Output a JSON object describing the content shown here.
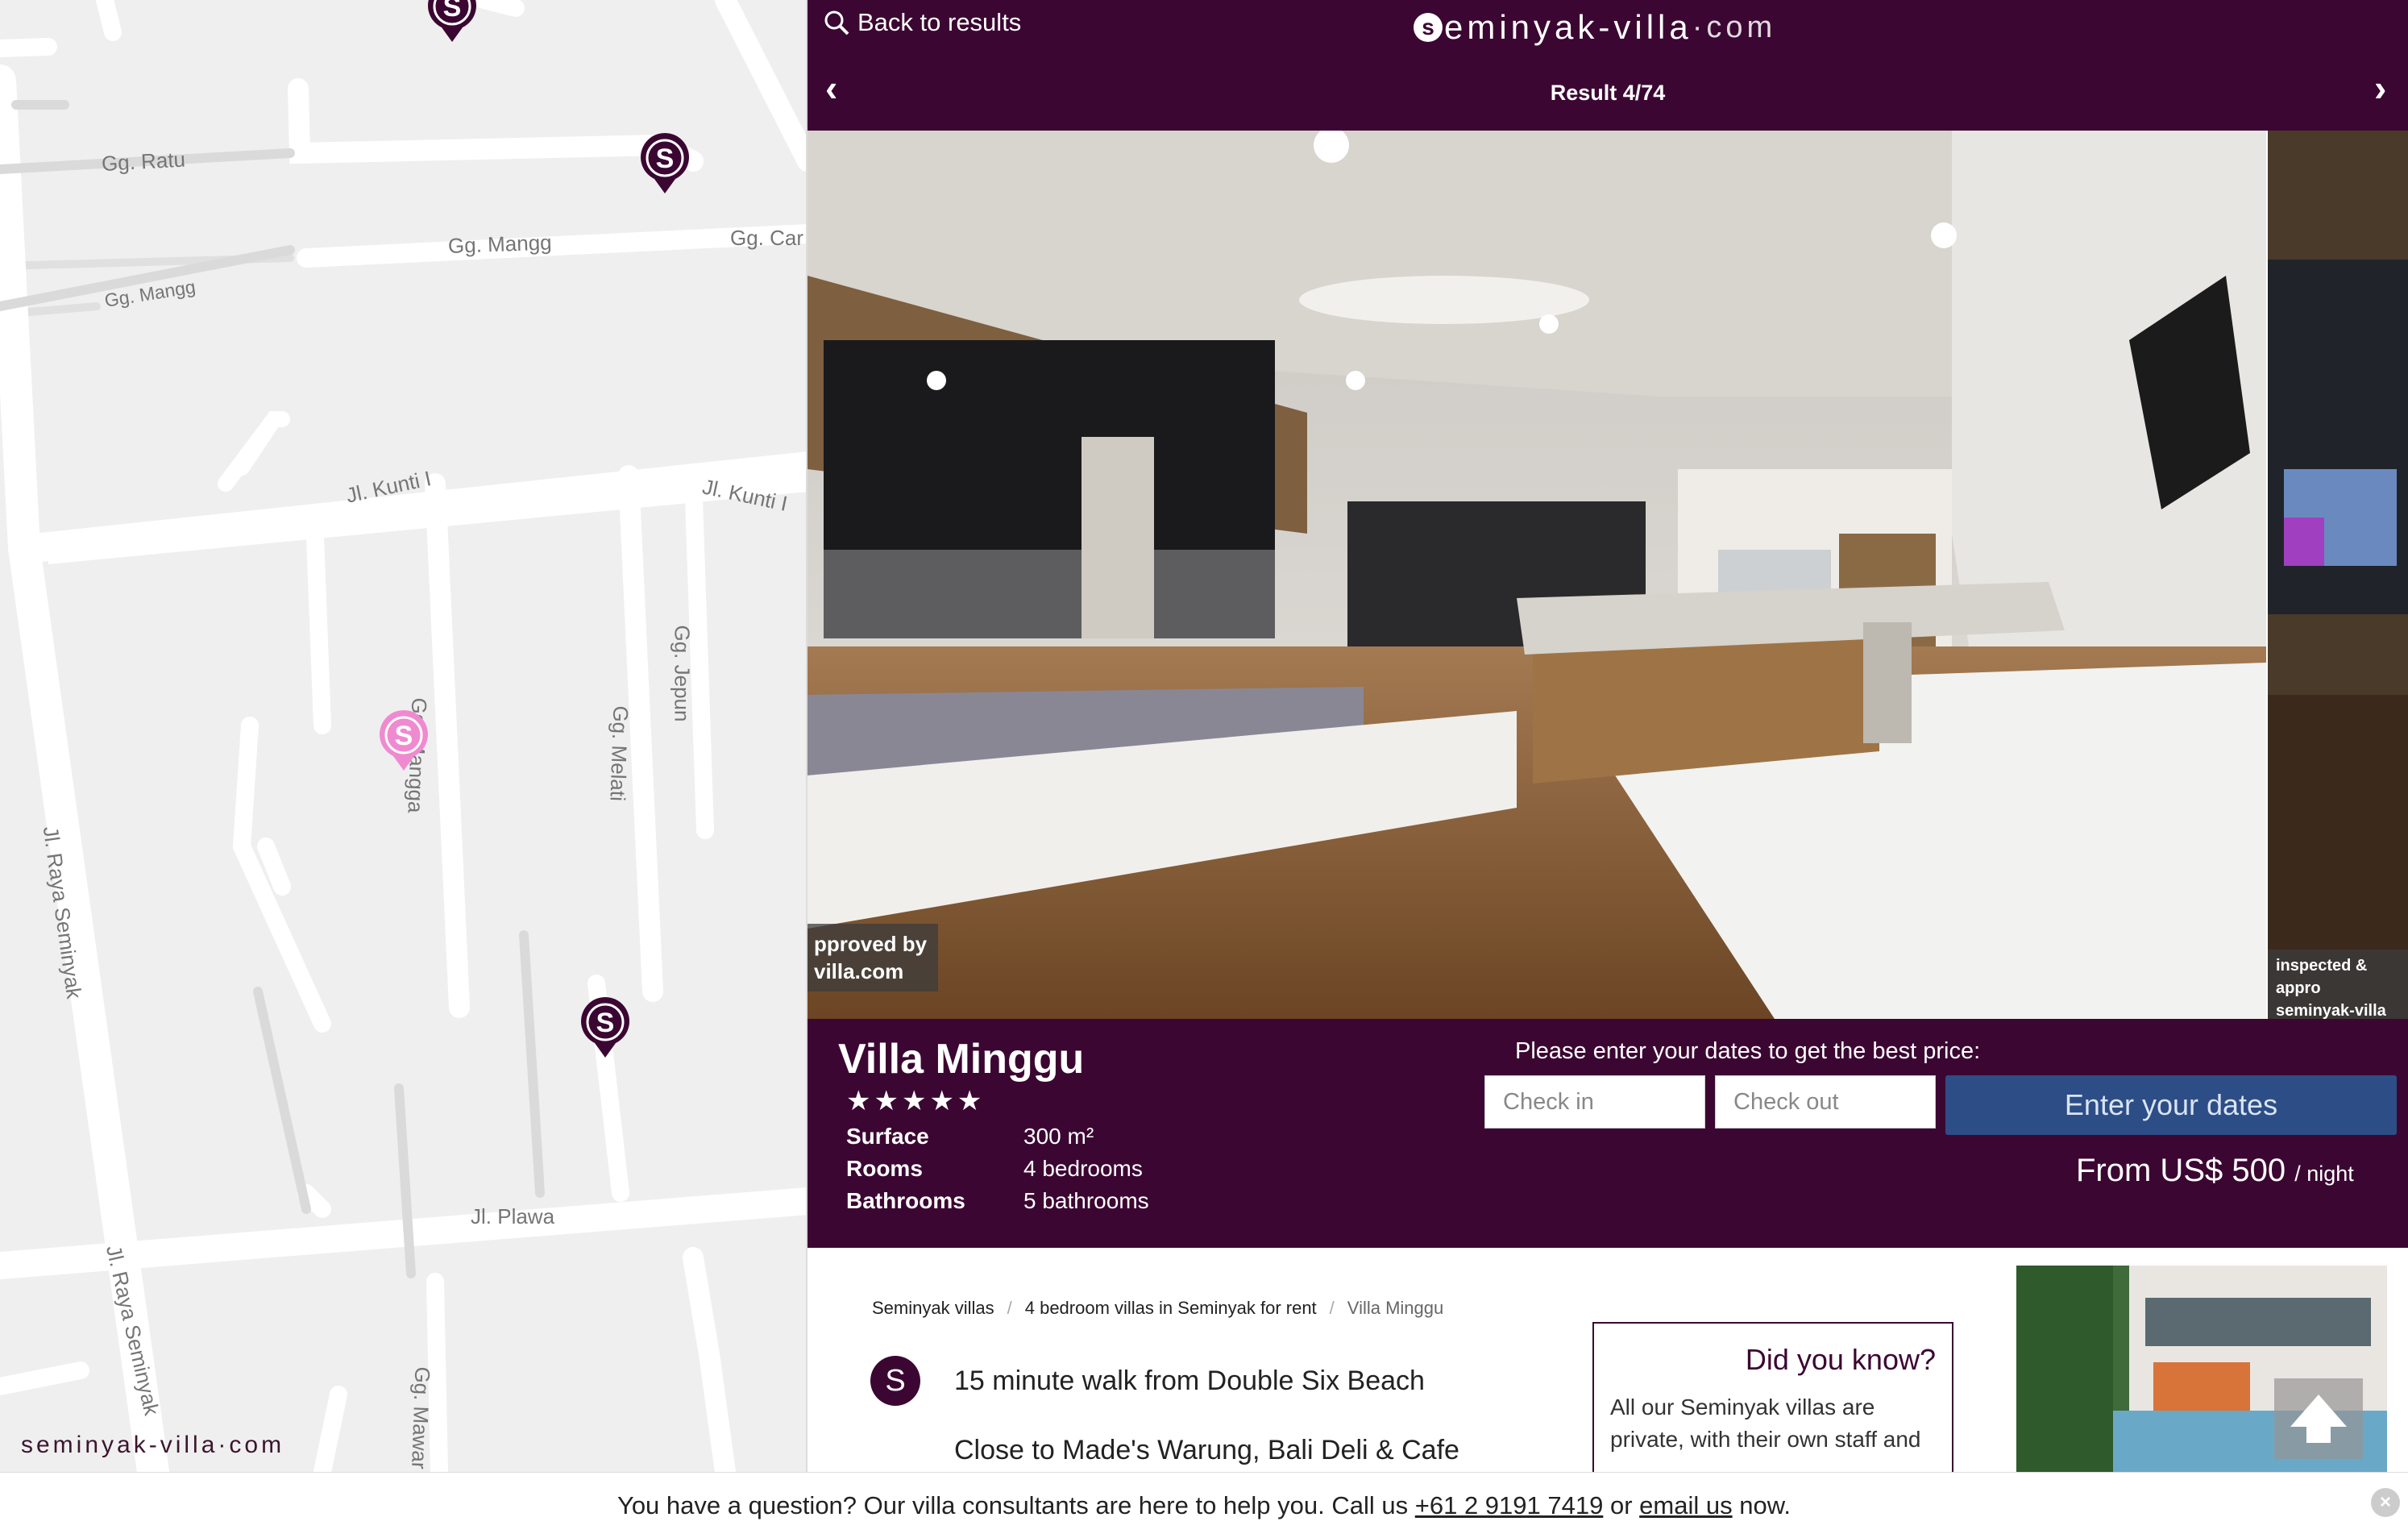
{
  "map": {
    "roads": [
      {
        "name": "road-gg-ratu",
        "label": "Gg. Ratu"
      },
      {
        "name": "road-gg-mangg",
        "label": "Gg. Mangg"
      },
      {
        "name": "road-gg-mangg-2",
        "label": "Gg. Mangg"
      },
      {
        "name": "road-gg-car",
        "label": "Gg. Car"
      },
      {
        "name": "road-jl-kunti",
        "label": "Jl. Kunti I"
      },
      {
        "name": "road-jl-kunti-2",
        "label": "Jl. Kunti I"
      },
      {
        "name": "road-gg-jepun",
        "label": "Gg. Jepun"
      },
      {
        "name": "road-gg-mangga",
        "label": "Gg. Mangga"
      },
      {
        "name": "road-gg-melati",
        "label": "Gg. Melati"
      },
      {
        "name": "road-jl-raya-seminyak",
        "label": "Jl. Raya Seminyak"
      },
      {
        "name": "road-jl-raya-seminyak-2",
        "label": "Jl. Raya Seminyak"
      },
      {
        "name": "road-jl-plawa",
        "label": "Jl. Plawa"
      },
      {
        "name": "road-gg-mawar",
        "label": "Gg. Mawar"
      }
    ],
    "logo": "seminyak-villa",
    "logo_suffix": "·com",
    "pin_color": "#3b0732",
    "active_pin_color": "#f08ad0"
  },
  "header": {
    "back_label": "Back to results",
    "brand_main": "eminyak-villa",
    "brand_suffix": "·com",
    "brand_initial": "s",
    "result_text": "Result 4/74",
    "prev_icon": "‹",
    "next_icon": "›",
    "bg_color": "#3b0732"
  },
  "gallery": {
    "badge_left": "pproved by\nvilla.com",
    "badge_right": "inspected & appro\nseminyak-villa"
  },
  "villa": {
    "name": "Villa Minggu",
    "stars": "★★★★★",
    "specs": [
      {
        "label": "Surface",
        "value": "300 m²"
      },
      {
        "label": "Rooms",
        "value": "4 bedrooms"
      },
      {
        "label": "Bathrooms",
        "value": "5 bathrooms"
      }
    ]
  },
  "booking": {
    "prompt": "Please enter your dates to get the best price:",
    "checkin_placeholder": "Check in",
    "checkout_placeholder": "Check out",
    "button_label": "Enter your dates",
    "price_text": "From US$ 500",
    "price_unit": "/ night",
    "button_color": "#2d4d86"
  },
  "content": {
    "breadcrumb": [
      "Seminyak villas",
      "4 bedroom villas in Seminyak for rent",
      "Villa Minggu"
    ],
    "feature_1": "15 minute walk from Double Six Beach",
    "feature_2": "Close to Made's Warung, Bali Deli & Cafe",
    "did_you_know_title": "Did you know?",
    "did_you_know_text": "All our Seminyak villas are private, with their own staff and"
  },
  "footer": {
    "text_before": "You have a question? Our villa consultants are here to help you. Call us",
    "phone": "+61 2 9191 7419",
    "text_or": "or",
    "email_label": "email us",
    "text_after": "now."
  }
}
